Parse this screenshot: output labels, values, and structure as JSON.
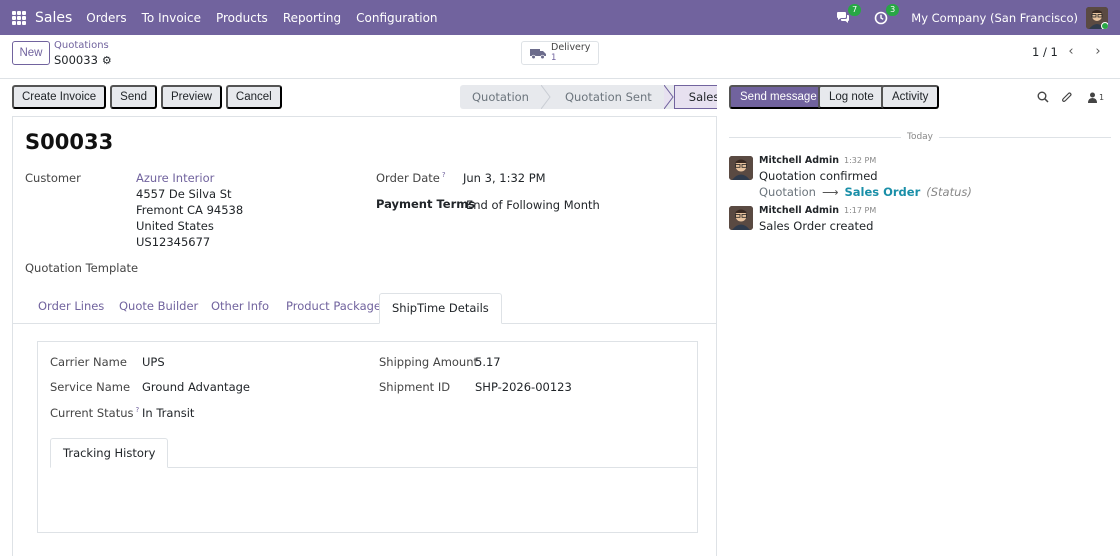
{
  "topnav": {
    "app_name": "Sales",
    "menu": [
      "Orders",
      "To Invoice",
      "Products",
      "Reporting",
      "Configuration"
    ],
    "messages_badge": "7",
    "activities_badge": "3",
    "company": "My Company (San Francisco)"
  },
  "control": {
    "new_label": "New",
    "breadcrumb": "Quotations",
    "record_name": "S00033",
    "delivery_label": "Delivery",
    "delivery_count": "1",
    "pager": "1 / 1"
  },
  "statusbar": {
    "actions": [
      "Create Invoice",
      "Send",
      "Preview",
      "Cancel"
    ],
    "stages": [
      "Quotation",
      "Quotation Sent",
      "Sales Order"
    ]
  },
  "form": {
    "title": "S00033",
    "customer_label": "Customer",
    "customer_name": "Azure Interior",
    "address_lines": [
      "4557 De Silva St",
      "Fremont CA 94538",
      "United States",
      "US12345677"
    ],
    "order_date_label": "Order Date",
    "order_date": "Jun 3, 1:32 PM",
    "payment_terms_label": "Payment Terms",
    "payment_terms": "End of Following Month",
    "quotation_template_label": "Quotation Template",
    "tabs": [
      "Order Lines",
      "Quote Builder",
      "Other Info",
      "Product Package",
      "ShipTime Details"
    ],
    "shiptime": {
      "carrier_label": "Carrier Name",
      "carrier": "UPS",
      "service_label": "Service Name",
      "service": "Ground Advantage",
      "status_label": "Current Status",
      "status": "In Transit",
      "amount_label": "Shipping Amount",
      "amount": "5.17",
      "shipment_id_label": "Shipment ID",
      "shipment_id": "SHP-2026-00123",
      "inner_tab": "Tracking History"
    }
  },
  "chatter": {
    "send_message": "Send message",
    "log_note": "Log note",
    "activity": "Activity",
    "followers_count": "1",
    "date_separator": "Today",
    "messages": [
      {
        "author": "Mitchell Admin",
        "time": "1:32 PM",
        "body": "Quotation confirmed",
        "tracking_old": "Quotation",
        "tracking_new": "Sales Order",
        "tracking_field": "(Status)"
      },
      {
        "author": "Mitchell Admin",
        "time": "1:17 PM",
        "body": "Sales Order created"
      }
    ]
  },
  "colors": {
    "brand": "#71639e",
    "success": "#28a745",
    "tracking_new": "#1a8fa8"
  }
}
